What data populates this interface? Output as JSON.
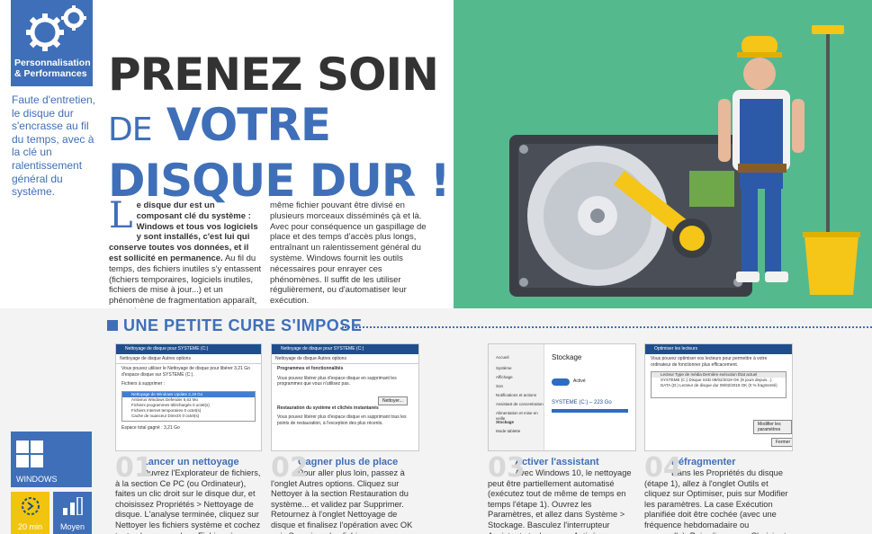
{
  "category": {
    "line1": "Personnalisation",
    "line2": "& Performances"
  },
  "lede": "Faute d'entretien, le disque dur s'encrasse au fil du temps, avec à la clé un ralentissement général du système.",
  "title": {
    "line1": "PRENEZ SOIN",
    "de": "DE",
    "line2": "VOTRE",
    "line3": "DISQUE DUR !"
  },
  "intro": {
    "dropcap": "L",
    "bold_part": "e disque dur est un composant clé du système : Windows et tous vos logiciels y sont installés, c'est lui qui conserve toutes vos données, et il est sollicité en permanence.",
    "rest_part": " Au fil du temps, des fichiers inutiles s'y entassent (fichiers temporaires, logiciels inutiles, fichiers de mise à jour...) et un phénomène de fragmentation apparaît, un seul et",
    "col2": "même fichier pouvant être divisé en plusieurs morceaux disséminés çà et là. Avec pour conséquence un gaspillage de place et des temps d'accès plus longs, entraînant un ralentissement général du système. Windows fournit les outils nécessaires pour enrayer ces phénomènes. Il suffit de les utiliser régulièrement, ou d'automatiser leur exécution."
  },
  "section": {
    "title": "UNE PETITE CURE S'IMPOSE"
  },
  "shots": {
    "s1": {
      "bar": "Nettoyage de disque pour SYSTEME (C:)",
      "tabs": "Nettoyage de disque   Autres options",
      "txt": "Vous pouvez utiliser le Nettoyage de disque pour libérer 3,21 Go d'espace disque sur SYSTEME (C:).",
      "list_label": "Fichiers à supprimer :",
      "rows": [
        "Nettoyage de Windows Update  2,19 Go",
        "Antivirus Windows Defender  6,63 Mo",
        "Fichiers programmes téléchargés  0 octet(s)",
        "Fichiers Internet temporaires  0 octet(s)",
        "Cache de nuanceur DirectX  0 octet(s)"
      ],
      "total": "Espace total gagné :   3,21 Go"
    },
    "s2": {
      "bar": "Nettoyage de disque pour SYSTEME (C:)",
      "tabs": "Nettoyage de disque   Autres options",
      "g1": "Programmes et fonctionnalités",
      "t1": "Vous pouvez libérer plus d'espace disque en supprimant les programmes que vous n'utilisez pas.",
      "btn": "Nettoyer...",
      "g2": "Restauration du système et clichés instantanés",
      "t2": "Vous pouvez libérer plus d'espace disque en supprimant tous les points de restauration, à l'exception des plus récents."
    },
    "s3": {
      "title": "Stockage",
      "drive": "SYSTEME (C:) – 223 Go",
      "toggle": "Activé",
      "items": [
        "Accueil",
        "Système",
        "Affichage",
        "Son",
        "Notifications et actions",
        "Assistant de concentration",
        "Alimentation et mise en veille",
        "Stockage",
        "Mode tablette"
      ]
    },
    "s4": {
      "bar": "Optimiser les lecteurs",
      "txt": "Vous pouvez optimiser vos lecteurs pour permettre à votre ordinateur de fonctionner plus efficacement.",
      "cols": "Lecteur   Type de média   Dernière exécution   État actuel",
      "rows": [
        "SYSTEME (C:)  Disque SSD  09/02/2019  OK (9 jours depuis...)",
        "DATA (D:)  Lecteur de disque dur  09/02/2019  OK (0 % fragmenté)"
      ],
      "btn": "Modifier les paramètres",
      "close": "Fermer"
    }
  },
  "steps": [
    {
      "num": "01",
      "head": "Lancer un nettoyage",
      "body": "Ouvrez l'Explorateur de fichiers, à la section Ce PC (ou Ordinateur), faites un clic droit sur le disque dur, et choisissez Propriétés > Nettoyage de disque. L'analyse terminée, cliquez sur Nettoyer les fichiers système et cochez toutes les cases dans Fichiers à supprimer."
    },
    {
      "num": "02",
      "head": "Gagner plus de place",
      "body": "Pour aller plus loin, passez à l'onglet Autres options. Cliquez sur Nettoyer à la section Restauration du système... et validez par Supprimer. Retournez à l'onglet Nettoyage de disque et finalisez l'opération avec OK puis Supprimer les fichiers."
    },
    {
      "num": "03",
      "head": "Activer l'assistant",
      "body": "Avec Windows 10, le nettoyage peut être partiellement automatisé (exécutez tout de même de temps en temps l'étape 1). Ouvrez les Paramètres, et allez dans Système > Stockage. Basculez l'interrupteur Assistant stockage sur Activé."
    },
    {
      "num": "04",
      "head": "Défragmenter",
      "body": "Dans les Propriétés du disque (étape 1), allez à l'onglet Outils et cliquez sur Optimiser, puis sur Modifier les paramètres. La case Exécution planifiée doit être cochée (avec une fréquence hebdomadaire ou mensuelle). Puis cliquez sur Choisir et cochez tous les disques. Validez."
    }
  ],
  "tiles": {
    "os": "WINDOWS",
    "time": "20 min",
    "level": "Moyen"
  },
  "colors": {
    "accent": "#3f6fb8",
    "illustration_bg": "#55b98e",
    "time_tile": "#f1c40f"
  }
}
